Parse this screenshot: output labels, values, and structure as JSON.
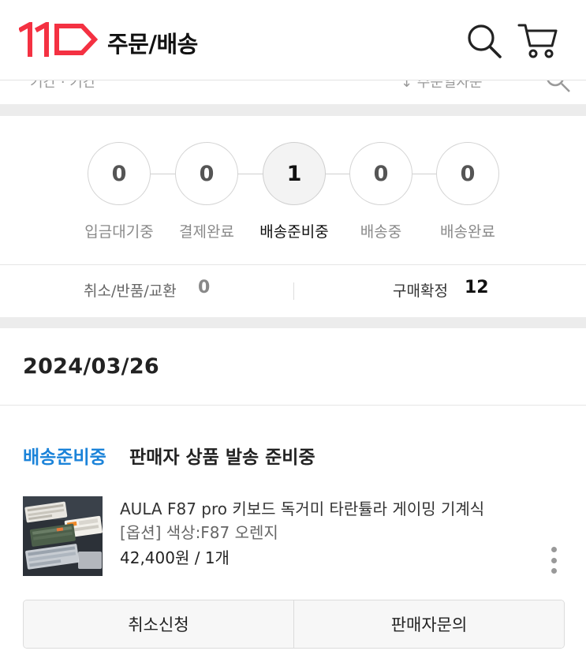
{
  "header": {
    "title": "주문/배송",
    "logo_icon": "11st-logo",
    "search_icon": "search-icon",
    "cart_icon": "cart-icon",
    "brand_color": "#f43142"
  },
  "partial_strip": {
    "left_text": "기간 · 기간",
    "right_text": "↕ 주문일자순"
  },
  "steps": [
    {
      "count": "0",
      "label": "입금대기중",
      "active": false
    },
    {
      "count": "0",
      "label": "결제완료",
      "active": false
    },
    {
      "count": "1",
      "label": "배송준비중",
      "active": true
    },
    {
      "count": "0",
      "label": "배송중",
      "active": false
    },
    {
      "count": "0",
      "label": "배송완료",
      "active": false
    }
  ],
  "summary": {
    "cancel_label": "취소/반품/교환",
    "cancel_count": "0",
    "confirm_label": "구매확정",
    "confirm_count": "12"
  },
  "order": {
    "date": "2024/03/26",
    "status_label": "배송준비중",
    "status_desc": "판매자 상품 발송 준비중",
    "status_color": "#1b83d9",
    "product": {
      "name": "AULA F87 pro 키보드 독거미 타란튤라 게이밍 기계식",
      "option": "[옵션] 색상:F87 오렌지",
      "price": "42,400원 / 1개"
    },
    "buttons": {
      "cancel": "취소신청",
      "inquiry": "판매자문의"
    }
  }
}
